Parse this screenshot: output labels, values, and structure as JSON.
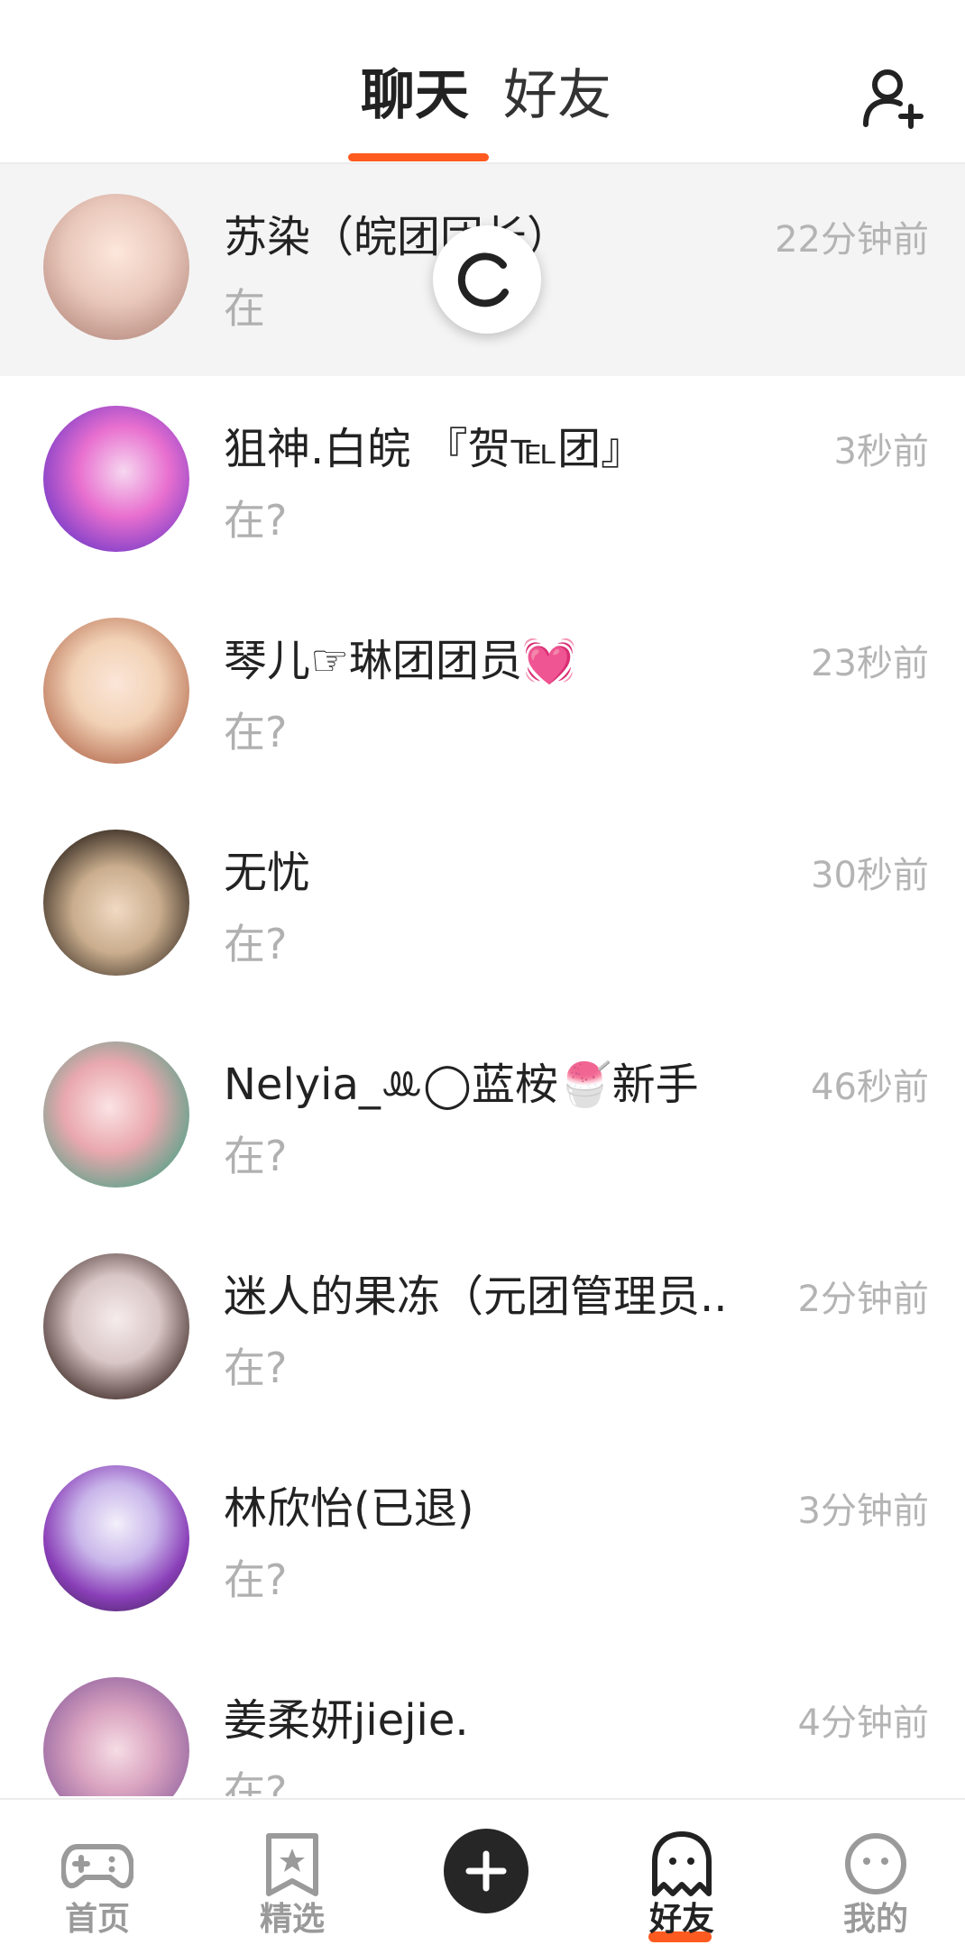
{
  "header": {
    "tabs": [
      {
        "label": "聊天",
        "active": true
      },
      {
        "label": "好友",
        "active": false
      }
    ],
    "add_friend_icon": "add-user-icon",
    "accent_color": "#ff5a1f"
  },
  "chats": [
    {
      "name": "苏染（皖团团长）",
      "time": "22分钟前",
      "message": "在",
      "highlight": true
    },
    {
      "name": "狙神.白皖 『贺℡团』",
      "time": "3秒前",
      "message": "在?"
    },
    {
      "name": "琴儿☞琳团团员💓",
      "time": "23秒前",
      "message": "在?"
    },
    {
      "name": "无忧",
      "time": "30秒前",
      "message": "在?"
    },
    {
      "name": "Nelyia_ꔛ◯蓝桉🍧新手",
      "time": "46秒前",
      "message": "在?"
    },
    {
      "name": "迷人的果冻（元团管理员..",
      "time": "2分钟前",
      "message": "在?"
    },
    {
      "name": "林欣怡(已退)",
      "time": "3分钟前",
      "message": "在?"
    },
    {
      "name": "姜柔妍jiejie.",
      "time": "4分钟前",
      "message": "在?"
    }
  ],
  "bottom_nav": [
    {
      "label": "首页",
      "icon": "gamepad-icon",
      "active": false
    },
    {
      "label": "精选",
      "icon": "star-bookmark-icon",
      "active": false
    },
    {
      "label": "",
      "icon": "plus-icon",
      "active": false
    },
    {
      "label": "好友",
      "icon": "ghost-icon",
      "active": true
    },
    {
      "label": "我的",
      "icon": "face-icon",
      "active": false
    }
  ]
}
